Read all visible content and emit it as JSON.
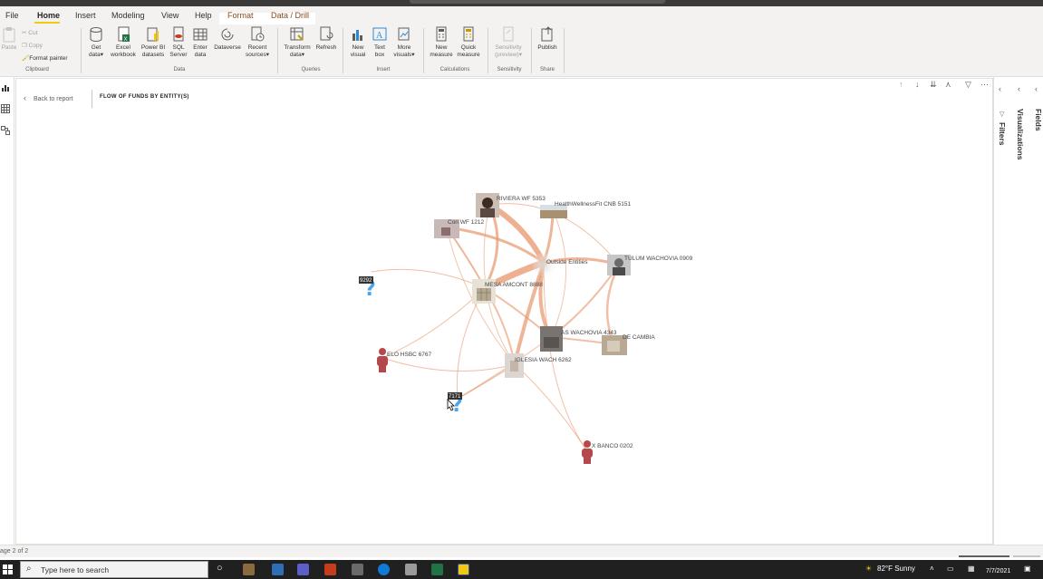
{
  "menubar": {
    "tabs": [
      "File",
      "Home",
      "Insert",
      "Modeling",
      "View",
      "Help",
      "Format",
      "Data / Drill"
    ],
    "active": "Home"
  },
  "ribbon": {
    "clipboard": {
      "paste": "Paste",
      "cut": "Cut",
      "copy": "Copy",
      "format_painter": "Format painter",
      "group": "Clipboard"
    },
    "data": {
      "get_data": [
        "Get",
        "data"
      ],
      "excel": [
        "Excel",
        "workbook"
      ],
      "powerbi": [
        "Power BI",
        "datasets"
      ],
      "sql": [
        "SQL",
        "Server"
      ],
      "enter": [
        "Enter",
        "data"
      ],
      "dataverse": [
        "Dataverse",
        ""
      ],
      "recent": [
        "Recent",
        "sources"
      ],
      "group": "Data"
    },
    "queries": {
      "transform": [
        "Transform",
        "data"
      ],
      "refresh": [
        "Refresh",
        ""
      ],
      "group": "Queries"
    },
    "insert": {
      "new_visual": [
        "New",
        "visual"
      ],
      "text_box": [
        "Text",
        "box"
      ],
      "more_visuals": [
        "More",
        "visuals"
      ],
      "group": "Insert"
    },
    "calculations": {
      "new_measure": [
        "New",
        "measure"
      ],
      "quick_measure": [
        "Quick",
        "measure"
      ],
      "group": "Calculations"
    },
    "sensitivity": {
      "label": [
        "Sensitivity",
        "(preview)"
      ],
      "group": "Sensitivity"
    },
    "share": {
      "publish": [
        "Publish",
        ""
      ],
      "group": "Share"
    }
  },
  "report": {
    "back": "Back to report",
    "title": "FLOW OF FUNDS BY ENTITY(S)"
  },
  "panes": {
    "filters": "Filters",
    "visualizations": "Visualizations",
    "fields": "Fields"
  },
  "graph": {
    "nodes": [
      {
        "id": "riviera",
        "label": "RIVIERA WF 5353",
        "kind": "photo"
      },
      {
        "id": "health",
        "label": "HealthWellnessFit CNB 5151",
        "kind": "photo"
      },
      {
        "id": "con",
        "label": "Con WF 1212",
        "kind": "photo"
      },
      {
        "id": "outside",
        "label": "Outside Entities",
        "kind": "hub"
      },
      {
        "id": "tulum",
        "label": "TULUM WACHOVIA 0909",
        "kind": "photo"
      },
      {
        "id": "mesa",
        "label": "MESA AMCONT 8888",
        "kind": "photo"
      },
      {
        "id": "q1",
        "label": "9292",
        "kind": "unknown"
      },
      {
        "id": "as",
        "label": "AS WACHOVIA 4343",
        "kind": "photo"
      },
      {
        "id": "cambia",
        "label": "DE CAMBIA",
        "kind": "photo"
      },
      {
        "id": "elo",
        "label": "ELO HSBC 6767",
        "kind": "person"
      },
      {
        "id": "iglesia",
        "label": "IGLESIA WACH 6262",
        "kind": "photo"
      },
      {
        "id": "q2",
        "label": "7171",
        "kind": "unknown"
      },
      {
        "id": "banco",
        "label": "X BANCO 0202",
        "kind": "person"
      }
    ],
    "edge_color": "#e8956b",
    "unknown_color": "#4da3e8",
    "person_color": "#b5484a"
  },
  "statusbar": {
    "page": "age 2 of 2"
  },
  "taskbar": {
    "search_placeholder": "Type here to search",
    "weather": "82°F Sunny",
    "date": "7/7/2021"
  }
}
